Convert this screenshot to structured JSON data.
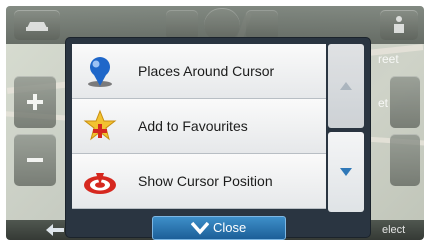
{
  "map": {
    "faint_labels": [
      "reet",
      "et",
      "elect"
    ]
  },
  "menu": {
    "items": [
      {
        "label": "Places Around Cursor",
        "icon": "map-pin-icon"
      },
      {
        "label": "Add to Favourites",
        "icon": "favourite-star-add-icon"
      },
      {
        "label": "Show Cursor Position",
        "icon": "cursor-position-icon"
      }
    ]
  },
  "scroll": {
    "up_icon": "chevron-up-icon",
    "down_icon": "chevron-down-icon"
  },
  "footer": {
    "close_label": "Close"
  },
  "colors": {
    "dialog_bg": "#2a3541",
    "close_button": "#2b7bb7",
    "scroll_arrow": "#2f78b8",
    "pin_blue": "#1f67c9",
    "target_red": "#d6281f",
    "star_yellow": "#f2c230"
  }
}
